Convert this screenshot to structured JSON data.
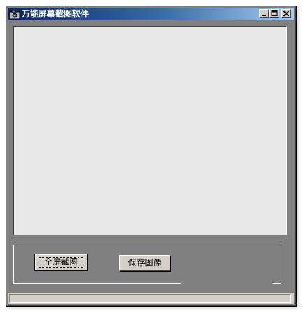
{
  "window": {
    "title": "万能屏幕截图软件",
    "icon": "camera-icon",
    "controls": {
      "minimize": "minimize-icon",
      "maximize": "maximize-icon",
      "close": "close-icon"
    }
  },
  "toolbar": {
    "fullscreen_label": "全屏截图",
    "save_label": "保存图像"
  },
  "status": {
    "text": ""
  },
  "colors": {
    "titlebar_start": "#0a246a",
    "titlebar_end": "#a6caf0",
    "window_bg": "#808080",
    "canvas_bg": "#e8e8e8",
    "button_face": "#d4d0c8"
  }
}
